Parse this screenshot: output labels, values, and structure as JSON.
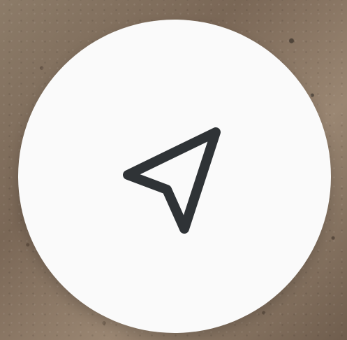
{
  "map": {
    "background": "satellite-map",
    "accent_colors": {
      "earth_light": "#9a8672",
      "earth_dark": "#6f5d4d"
    }
  },
  "controls": {
    "my_location_button": {
      "icon": "navigation-arrow-icon",
      "background_color": "#fafafa",
      "icon_color": "#2f3336"
    }
  }
}
